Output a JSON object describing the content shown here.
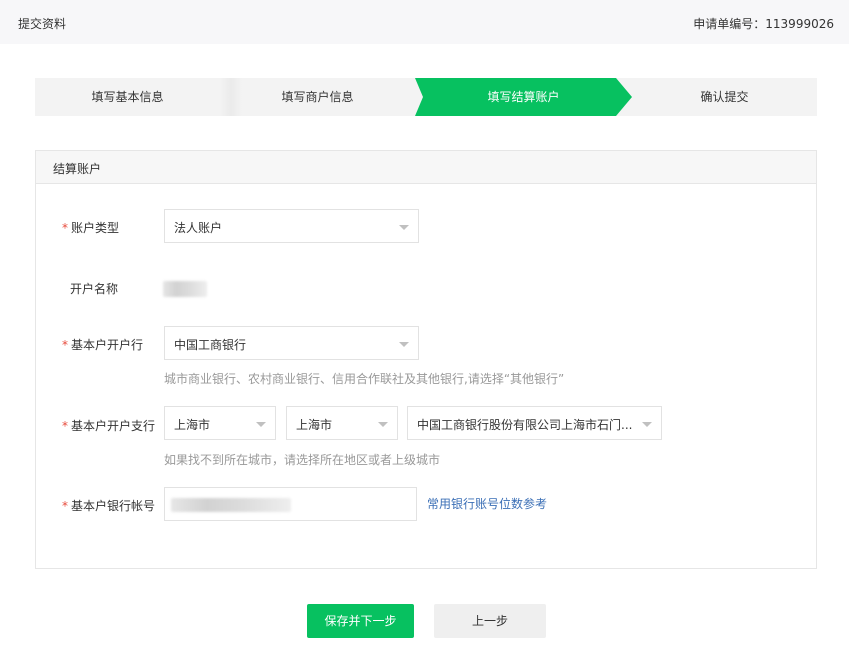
{
  "header": {
    "title": "提交资料",
    "application_no_label": "申请单编号：",
    "application_no": "113999026"
  },
  "steps": [
    {
      "label": "填写基本信息",
      "state": "done"
    },
    {
      "label": "填写商户信息",
      "state": "done"
    },
    {
      "label": "填写结算账户",
      "state": "active"
    },
    {
      "label": "确认提交",
      "state": "todo"
    }
  ],
  "colors": {
    "accent": "#07c160",
    "required": "#e84c3d",
    "link": "#3b6fb6",
    "hint": "#999999"
  },
  "panel": {
    "title": "结算账户"
  },
  "form": {
    "account_type": {
      "required_mark": "*",
      "label": "账户类型",
      "value": "法人账户"
    },
    "account_name": {
      "label": "开户名称"
    },
    "bank": {
      "required_mark": "*",
      "label": "基本户开户行",
      "value": "中国工商银行",
      "hint": "城市商业银行、农村商业银行、信用合作联社及其他银行,请选择“其他银行”"
    },
    "branch": {
      "required_mark": "*",
      "label": "基本户开户支行",
      "province": "上海市",
      "city": "上海市",
      "branch_name": "中国工商银行股份有限公司上海市石门...",
      "hint": "如果找不到所在城市，请选择所在地区或者上级城市"
    },
    "account_number": {
      "required_mark": "*",
      "label": "基本户银行帐号",
      "reference_link": "常用银行账号位数参考"
    }
  },
  "actions": {
    "save_next": "保存并下一步",
    "prev": "上一步"
  }
}
